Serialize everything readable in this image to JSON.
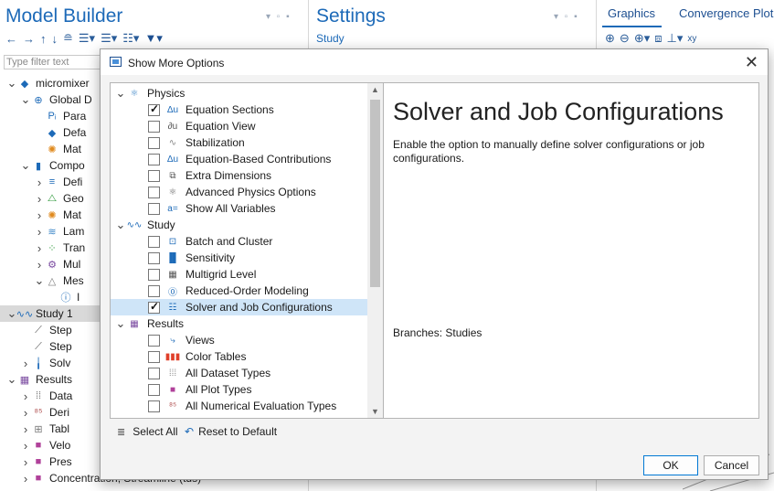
{
  "model_builder": {
    "title": "Model Builder",
    "filter_placeholder": "Type filter text",
    "tree": [
      {
        "label": "micromixer",
        "icon": "model-icon"
      },
      {
        "label": "Global D",
        "icon": "globe-icon"
      },
      {
        "label": "Para",
        "icon": "parameters-icon"
      },
      {
        "label": "Defa",
        "icon": "defaults-icon"
      },
      {
        "label": "Mat",
        "icon": "materials-icon"
      },
      {
        "label": "Compo",
        "icon": "component-icon"
      },
      {
        "label": "Defi",
        "icon": "definitions-icon"
      },
      {
        "label": "Geo",
        "icon": "geometry-icon"
      },
      {
        "label": "Mat",
        "icon": "materials-icon"
      },
      {
        "label": "Lam",
        "icon": "laminar-flow-icon"
      },
      {
        "label": "Tran",
        "icon": "transport-icon"
      },
      {
        "label": "Mul",
        "icon": "multiphysics-icon"
      },
      {
        "label": "Mes",
        "icon": "mesh-icon"
      },
      {
        "label": "I",
        "icon": "info-icon"
      },
      {
        "label": "Study 1",
        "icon": "study-icon"
      },
      {
        "label": "Step",
        "icon": "step-icon"
      },
      {
        "label": "Step",
        "icon": "step-icon"
      },
      {
        "label": "Solv",
        "icon": "solver-icon"
      },
      {
        "label": "Results",
        "icon": "results-icon"
      },
      {
        "label": "Data",
        "icon": "datasets-icon"
      },
      {
        "label": "Deri",
        "icon": "derived-values-icon"
      },
      {
        "label": "Tabl",
        "icon": "tables-icon"
      },
      {
        "label": "Velo",
        "icon": "plot-group-icon"
      },
      {
        "label": "Pres",
        "icon": "plot-group-icon"
      },
      {
        "label": "Concentration, Streamline (tds)",
        "icon": "plot-group-icon"
      }
    ]
  },
  "settings": {
    "title": "Settings",
    "subtitle": "Study"
  },
  "graphics": {
    "tabs": [
      "Graphics",
      "Convergence Plot"
    ]
  },
  "dialog": {
    "title": "Show More Options",
    "groups": [
      {
        "label": "Physics",
        "icon": "physics-icon",
        "items": [
          {
            "label": "Equation Sections",
            "checked": true,
            "icon": "equation-sections-icon"
          },
          {
            "label": "Equation View",
            "checked": false,
            "icon": "equation-view-icon"
          },
          {
            "label": "Stabilization",
            "checked": false,
            "icon": "stabilization-icon"
          },
          {
            "label": "Equation-Based Contributions",
            "checked": false,
            "icon": "equation-based-icon"
          },
          {
            "label": "Extra Dimensions",
            "checked": false,
            "icon": "extra-dimensions-icon"
          },
          {
            "label": "Advanced Physics Options",
            "checked": false,
            "icon": "advanced-physics-icon"
          },
          {
            "label": "Show All Variables",
            "checked": false,
            "icon": "variables-icon"
          }
        ]
      },
      {
        "label": "Study",
        "icon": "study-icon",
        "items": [
          {
            "label": "Batch and Cluster",
            "checked": false,
            "icon": "batch-cluster-icon"
          },
          {
            "label": "Sensitivity",
            "checked": false,
            "icon": "sensitivity-icon"
          },
          {
            "label": "Multigrid Level",
            "checked": false,
            "icon": "multigrid-icon"
          },
          {
            "label": "Reduced-Order Modeling",
            "checked": false,
            "icon": "reduced-order-icon"
          },
          {
            "label": "Solver and Job Configurations",
            "checked": true,
            "icon": "solver-config-icon",
            "selected": true
          }
        ]
      },
      {
        "label": "Results",
        "icon": "results-icon",
        "items": [
          {
            "label": "Views",
            "checked": false,
            "icon": "views-icon"
          },
          {
            "label": "Color Tables",
            "checked": false,
            "icon": "color-tables-icon"
          },
          {
            "label": "All Dataset Types",
            "checked": false,
            "icon": "dataset-types-icon"
          },
          {
            "label": "All Plot Types",
            "checked": false,
            "icon": "plot-types-icon"
          },
          {
            "label": "All Numerical Evaluation Types",
            "checked": false,
            "icon": "numerical-eval-icon"
          }
        ]
      }
    ],
    "detail_title": "Solver and Job Configurations",
    "detail_description": "Enable the option to manually define solver configurations or job configurations.",
    "detail_branches": "Branches: Studies",
    "select_all": "Select All",
    "reset_default": "Reset to Default",
    "ok": "OK",
    "cancel": "Cancel"
  }
}
